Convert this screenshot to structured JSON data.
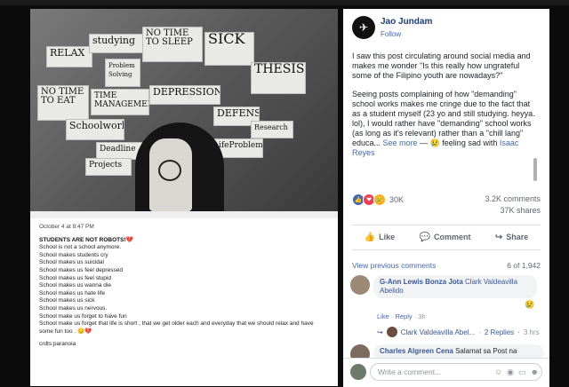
{
  "post": {
    "author": "Jao Jundam",
    "follow_label": "Follow",
    "paragraph1": "I saw this post circulating around social media and makes me wonder \"Is this really how ungrateful some of the Filipino youth are nowadays?\"",
    "paragraph2": "Seeing posts complaining of how \"demanding\" school works makes me cringe due to the fact that as a student myself (23 yo and still studying. heyya. lol), I would rather have \"demanding\" school works (as long as it's relevant) rather than a \"chill lang\" educa...",
    "see_more": "See more",
    "feeling_text": "— 😢 feeling sad with",
    "tagged": "Isaac Reyes",
    "reaction_count": "30K",
    "comments_count": "3.2K comments",
    "shares_count": "37K shares"
  },
  "actions": {
    "like": "Like",
    "comment": "Comment",
    "share": "Share"
  },
  "comments": {
    "view_previous": "View previous comments",
    "count": "6 of 1,942",
    "c1_author": "G-Ann Lewis Bonza Jota",
    "c1_text": "Clark Valdeavilla Abelido",
    "c1_like": "Like",
    "c1_reply": "Reply",
    "c1_time": "3h",
    "reply_author": "Clark Valdeavilla Abel...",
    "reply_count": "2 Replies",
    "reply_time": "3 hrs",
    "c2_author": "Charles Algreen Cena",
    "c2_text": "Salamat sa Post na",
    "write_placeholder": "Write a comment..."
  },
  "photo": {
    "notes": [
      "RELAX",
      "studying",
      "NO TIME TO SLEEP",
      "SICK",
      "THESIS",
      "Problem Solving",
      "NO TIME TO EAT",
      "TIME MANAGEMENT",
      "DEPRESSION",
      "Schoolworks",
      "DEFENSE",
      "Research",
      "Deadline",
      "Projects",
      "LifeProblem"
    ]
  },
  "caption": {
    "date": "October 4 at 8:47 PM",
    "lines": [
      "STUDENTS ARE NOT ROBOTS!💔",
      "School is not a school anymore.",
      "School makes students cry",
      "School makes us suicidal",
      "School makes us feel depressed",
      "School makes us feel stupid",
      "School makes us wanna die",
      "School makes us hate life",
      "School makes us sick",
      "School makes us nervous.",
      "School make us forget to have fun",
      "School make us forget that life is short , that we get older each and everyday that we should relax and have some fun too . 😔💔"
    ],
    "credits": "crdts:paranoia"
  }
}
